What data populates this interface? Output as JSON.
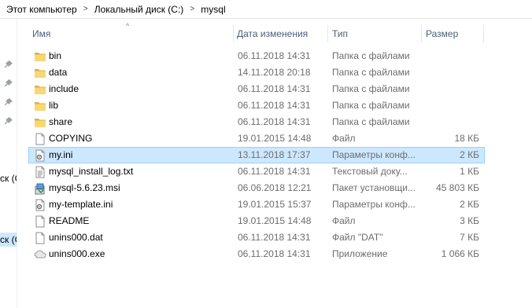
{
  "breadcrumb": [
    "Этот компьютер",
    "Локальный диск (C:)",
    "mysql"
  ],
  "nav": {
    "label1": "ск (С",
    "label2": "ск (С"
  },
  "columns": {
    "name": "Имя",
    "date": "Дата изменения",
    "type": "Тип",
    "size": "Размер"
  },
  "files": [
    {
      "name": "bin",
      "date": "06.11.2018 14:31",
      "type": "Папка с файлами",
      "size": "",
      "icon": "folder"
    },
    {
      "name": "data",
      "date": "14.11.2018 20:18",
      "type": "Папка с файлами",
      "size": "",
      "icon": "folder"
    },
    {
      "name": "include",
      "date": "06.11.2018 14:31",
      "type": "Папка с файлами",
      "size": "",
      "icon": "folder"
    },
    {
      "name": "lib",
      "date": "06.11.2018 14:31",
      "type": "Папка с файлами",
      "size": "",
      "icon": "folder"
    },
    {
      "name": "share",
      "date": "06.11.2018 14:31",
      "type": "Папка с файлами",
      "size": "",
      "icon": "folder"
    },
    {
      "name": "COPYING",
      "date": "19.01.2015 14:48",
      "type": "Файл",
      "size": "18 КБ",
      "icon": "file"
    },
    {
      "name": "my.ini",
      "date": "13.11.2018 17:37",
      "type": "Параметры конф...",
      "size": "2 КБ",
      "icon": "settings-file",
      "selected": true
    },
    {
      "name": "mysql_install_log.txt",
      "date": "06.11.2018 14:31",
      "type": "Текстовый доку...",
      "size": "1 КБ",
      "icon": "text-file"
    },
    {
      "name": "mysql-5.6.23.msi",
      "date": "06.06.2018 12:21",
      "type": "Пакет установщи...",
      "size": "45 803 КБ",
      "icon": "installer"
    },
    {
      "name": "my-template.ini",
      "date": "19.01.2015 15:37",
      "type": "Параметры конф...",
      "size": "2 КБ",
      "icon": "settings-file"
    },
    {
      "name": "README",
      "date": "19.01.2015 14:48",
      "type": "Файл",
      "size": "3 КБ",
      "icon": "file"
    },
    {
      "name": "unins000.dat",
      "date": "06.11.2018 14:31",
      "type": "Файл \"DAT\"",
      "size": "7 КБ",
      "icon": "file"
    },
    {
      "name": "unins000.exe",
      "date": "06.11.2018 14:31",
      "type": "Приложение",
      "size": "1 066 КБ",
      "icon": "app"
    }
  ]
}
